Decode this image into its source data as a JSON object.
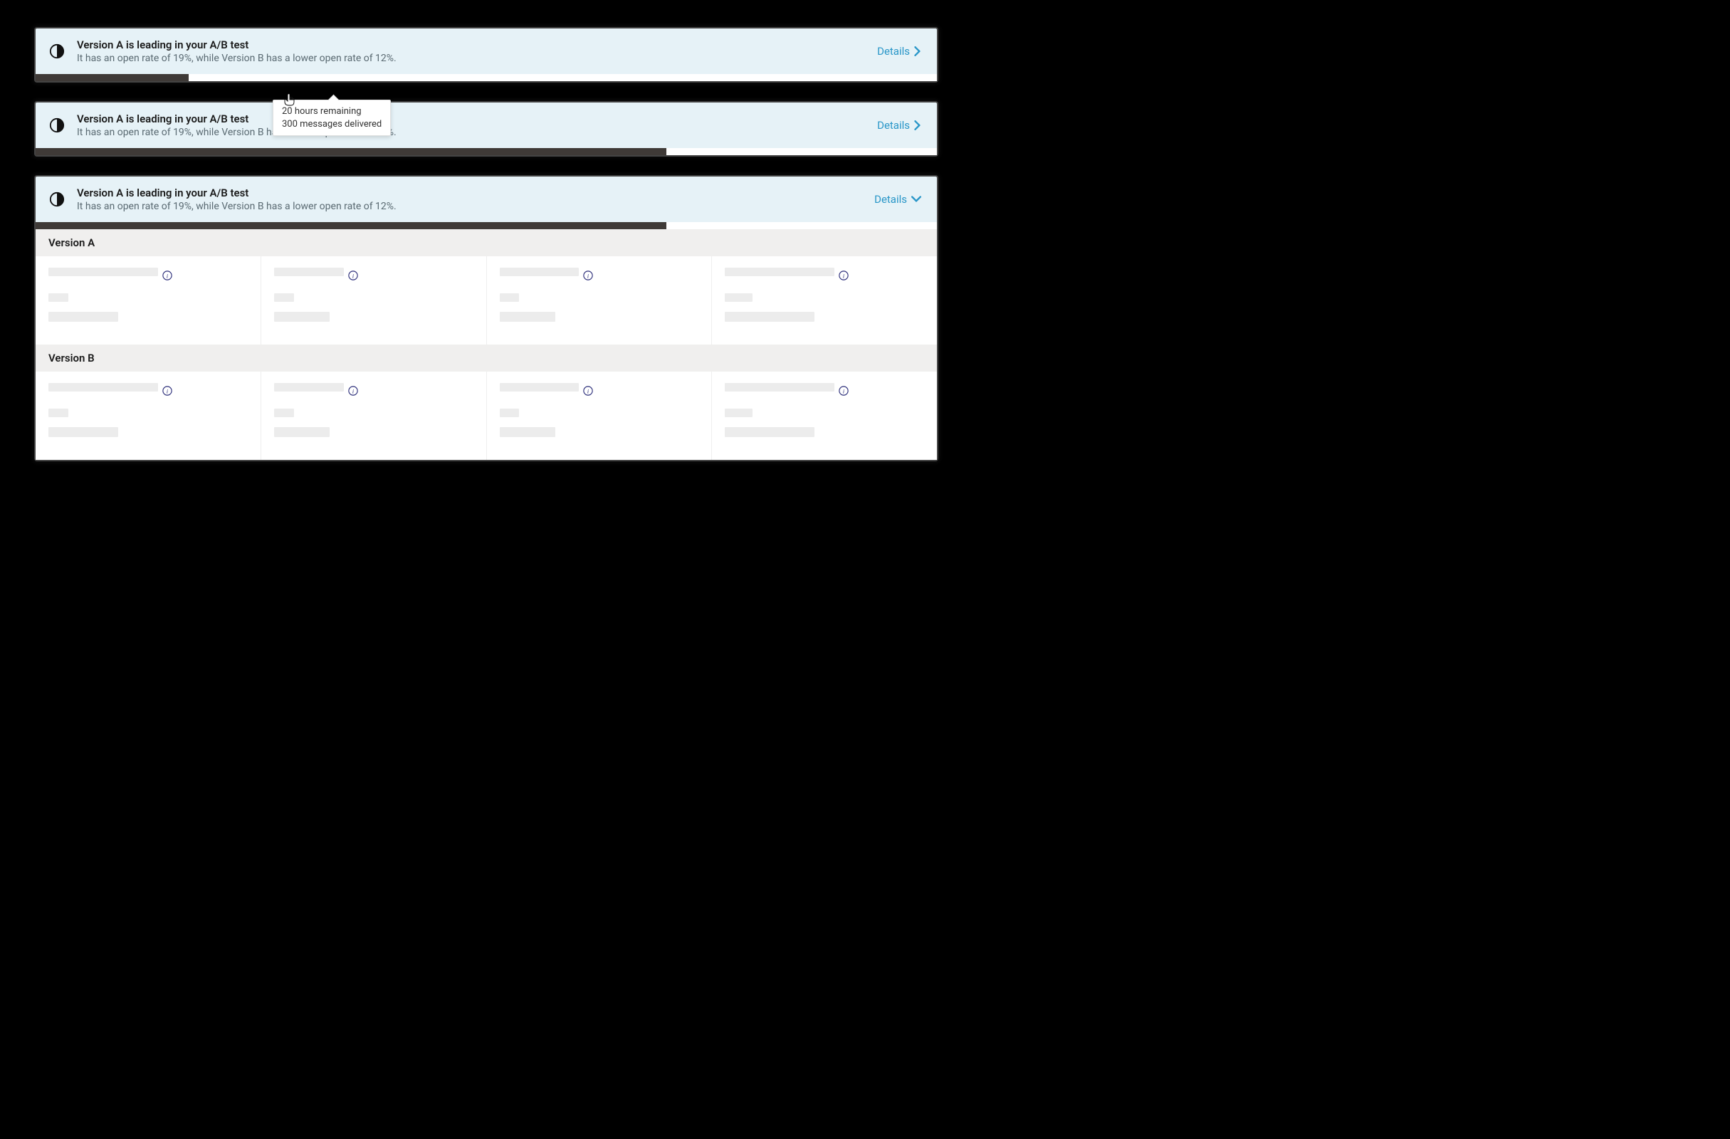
{
  "banner": {
    "title": "Version A is leading in your A/B test",
    "subtitle": "It has an open rate of 19%, while Version B has a lower open rate of 12%.",
    "details_label": "Details"
  },
  "tooltip": {
    "line1": "20 hours remaining",
    "line2": "300 messages delivered"
  },
  "progress": {
    "card1_percent": 17,
    "card2_percent": 70,
    "card3_percent": 70
  },
  "expanded": {
    "section_a": "Version A",
    "section_b": "Version B"
  },
  "colors": {
    "banner_bg": "#e6f2f7",
    "link": "#2896c8",
    "progress_fill": "#3f3a37",
    "info_icon": "#2c2e7a"
  }
}
